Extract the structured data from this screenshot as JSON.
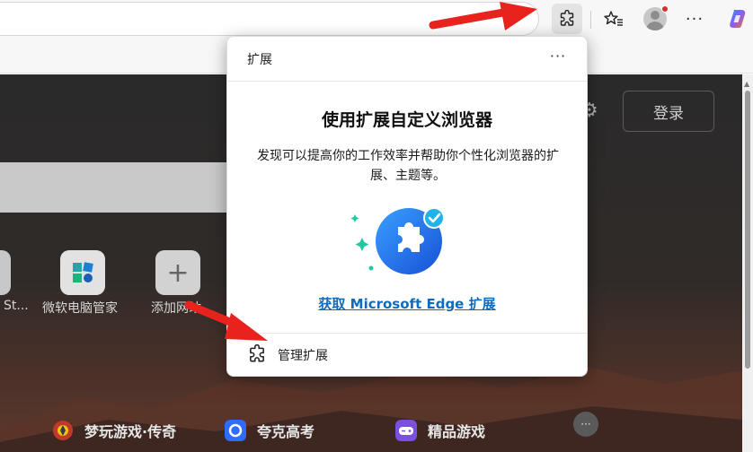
{
  "toolbar": {
    "more_glyph": "···",
    "icons": [
      "puzzle-icon",
      "star-list-icon",
      "profile-icon",
      "more-icon",
      "copilot-icon"
    ]
  },
  "page": {
    "login_label": "登录",
    "tiles": [
      {
        "label": "St..."
      },
      {
        "label": "微软电脑管家"
      },
      {
        "label": "添加网站",
        "glyph": "+"
      }
    ],
    "bottom_links": [
      {
        "label": "梦玩游戏·传奇"
      },
      {
        "label": "夸克高考"
      },
      {
        "label": "精品游戏"
      }
    ],
    "more_glyph": "···"
  },
  "popup": {
    "title": "扩展",
    "more_glyph": "···",
    "heading": "使用扩展自定义浏览器",
    "description": "发现可以提高你的工作效率并帮助你个性化浏览器的扩展、主题等。",
    "link": "获取 Microsoft Edge 扩展",
    "manage_label": "管理扩展"
  },
  "colors": {
    "link": "#0f6cbd",
    "arrow": "#e8231d",
    "hero_blue": "#1e6fe0",
    "hero_accent": "#1fc7a5"
  }
}
